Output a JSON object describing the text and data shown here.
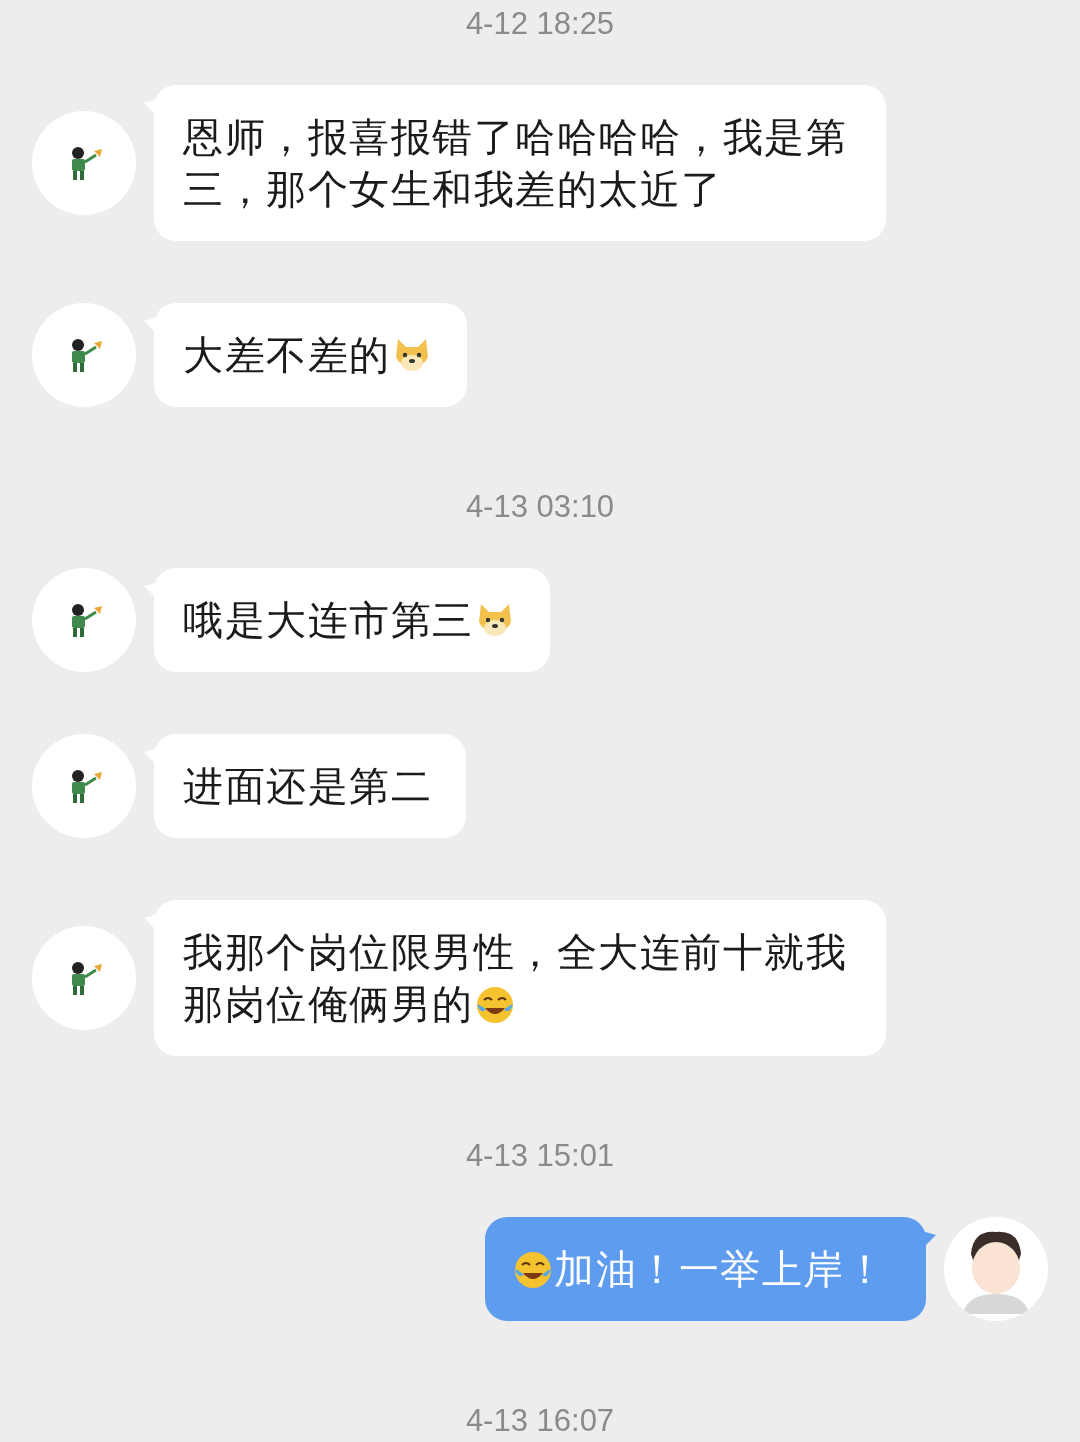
{
  "chat": [
    {
      "kind": "timestamp",
      "text": "4-12 18:25"
    },
    {
      "kind": "received",
      "parts": [
        {
          "kind": "text",
          "text": "恩师，报喜报错了哈哈哈哈，我是第三，那个女生和我差的太近了"
        }
      ]
    },
    {
      "kind": "received",
      "parts": [
        {
          "kind": "text",
          "text": "大差不差的"
        },
        {
          "kind": "dog"
        }
      ]
    },
    {
      "kind": "timestamp",
      "text": "4-13 03:10"
    },
    {
      "kind": "received",
      "parts": [
        {
          "kind": "text",
          "text": "哦是大连市第三"
        },
        {
          "kind": "dog"
        }
      ]
    },
    {
      "kind": "received",
      "parts": [
        {
          "kind": "text",
          "text": "进面还是第二"
        }
      ]
    },
    {
      "kind": "received",
      "parts": [
        {
          "kind": "text",
          "text": "我那个岗位限男性，全大连前十就我那岗位俺俩男的"
        },
        {
          "kind": "laugh"
        }
      ]
    },
    {
      "kind": "timestamp",
      "text": "4-13 15:01"
    },
    {
      "kind": "sent",
      "parts": [
        {
          "kind": "laugh"
        },
        {
          "kind": "text",
          "text": "加油！一举上岸！"
        }
      ]
    },
    {
      "kind": "timestamp",
      "text": "4-13 16:07"
    }
  ]
}
